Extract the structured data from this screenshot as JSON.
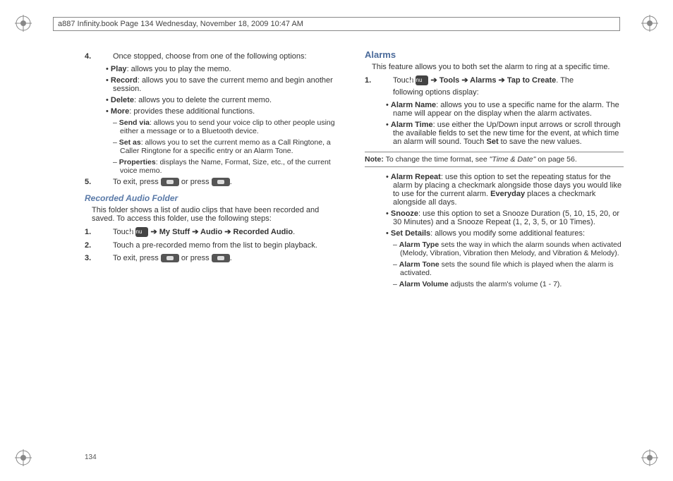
{
  "header": "a887 Infinity.book  Page 134  Wednesday, November 18, 2009  10:47 AM",
  "page_number": "134",
  "left": {
    "step4_num": "4.",
    "step4_text": "Once stopped, choose from one of the following options:",
    "b_play": "Play",
    "b_play_t": ": allows you to play the memo.",
    "b_record": "Record",
    "b_record_t": ": allows you to save the current memo and begin another session.",
    "b_delete": "Delete",
    "b_delete_t": ": allows you to delete the current memo.",
    "b_more": "More",
    "b_more_t": ": provides these additional functions.",
    "d_sendvia": "Send via",
    "d_sendvia_t": ": allows you to send your voice clip to other people using either a message or to a Bluetooth device.",
    "d_setas": "Set as",
    "d_setas_t": ": allows you to set the current memo as a Call Ringtone, a Caller Ringtone for a specific entry or an Alarm Tone.",
    "d_props": "Properties",
    "d_props_t": ": displays the Name, Format, Size, etc., of the current voice memo.",
    "step5_num": "5.",
    "step5_a": "To exit, press ",
    "step5_b": " or press ",
    "step5_c": ".",
    "heading": "Recorded Audio Folder",
    "intro": "This folder shows a list of audio clips that have been recorded and saved. To access this folder, use the following steps:",
    "r_step1_num": "1.",
    "r_step1_a": "Touch ",
    "r_step1_b": " ➔ My Stuff ➔ Audio ➔ Recorded Audio",
    "r_step1_c": ".",
    "r_step2_num": "2.",
    "r_step2_t": "Touch a pre-recorded memo from the list to begin playback.",
    "r_step3_num": "3.",
    "r_step3_a": "To exit, press ",
    "r_step3_b": " or press ",
    "r_step3_c": "."
  },
  "right": {
    "heading": "Alarms",
    "intro": "This feature allows you to both set the alarm to ring at a specific time.",
    "a_step1_num": "1.",
    "a_step1_a": "Touch ",
    "a_step1_b": " ➔ Tools ➔ Alarms ➔ Tap to Create",
    "a_step1_c": ". The",
    "a_step1_d": "following options display:",
    "b_name": "Alarm Name",
    "b_name_t": ": allows you to use a specific name for the alarm. The name will appear on the display when the alarm activates.",
    "b_time": "Alarm Time",
    "b_time_t": ": use either the Up/Down input arrows or scroll through the available fields to set the new time for the event, at which time an alarm will sound. Touch ",
    "b_time_set": "Set",
    "b_time_t2": " to save the new values.",
    "note_a": "Note:",
    "note_b": " To change the time format, see ",
    "note_ref": "\"Time & Date\"",
    "note_c": " on page 56.",
    "b_repeat": "Alarm Repeat",
    "b_repeat_t": ": use this option to set the repeating status for the alarm by placing a checkmark alongside those days you would like to use for the current alarm. ",
    "b_repeat_ev": "Everyday",
    "b_repeat_t2": " places a checkmark alongside all days.",
    "b_snooze": "Snooze",
    "b_snooze_t": ": use this option to set a Snooze Duration (5, 10, 15, 20, or 30 Minutes) and a Snooze Repeat (1, 2, 3, 5, or 10 Times).",
    "b_details": "Set Details",
    "b_details_t": ": allows you modify some additional features:",
    "d_type": "Alarm Type",
    "d_type_t": " sets the way in which the alarm sounds when activated (Melody, Vibration, Vibration then Melody, and Vibration & Melody).",
    "d_tone": "Alarm Tone",
    "d_tone_t": " sets the sound file which is played when the alarm is activated.",
    "d_vol": "Alarm Volume",
    "d_vol_t": " adjusts the alarm's volume (1 - 7)."
  }
}
